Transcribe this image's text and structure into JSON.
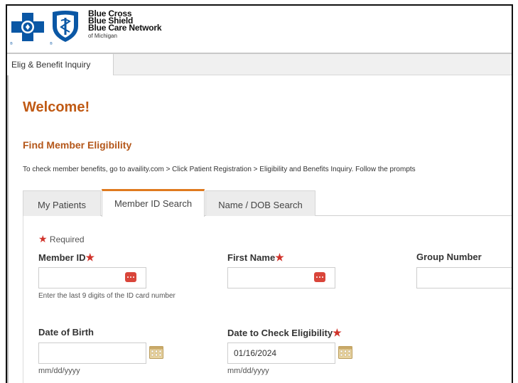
{
  "brand": {
    "line1": "Blue Cross",
    "line2": "Blue Shield",
    "line3": "Blue Care Network",
    "line4": "of Michigan",
    "colors": {
      "primary": "#0a57a5",
      "accent": "#c05a14",
      "required": "#d0332b"
    }
  },
  "topbar": {
    "tab_label": "Elig & Benefit Inquiry"
  },
  "welcome": "Welcome!",
  "section_title": "Find Member Eligibility",
  "instructions": "To check member benefits, go to availity.com > Click Patient Registration > Eligibility and Benefits Inquiry. Follow the prompts",
  "tabs": [
    {
      "label": "My Patients"
    },
    {
      "label": "Member ID Search",
      "active": true
    },
    {
      "label": "Name / DOB Search"
    }
  ],
  "form": {
    "required_note": "Required",
    "required_marker": "★",
    "member_id": {
      "label": "Member ID",
      "value": "",
      "hint": "Enter the last 9 digits of the ID card number"
    },
    "first_name": {
      "label": "First Name",
      "value": ""
    },
    "group_number": {
      "label": "Group Number",
      "value": ""
    },
    "date_of_birth": {
      "label": "Date of Birth",
      "value": "",
      "format_hint": "mm/dd/yyyy"
    },
    "date_to_check": {
      "label": "Date to Check Eligibility",
      "value": "01/16/2024",
      "format_hint": "mm/dd/yyyy"
    }
  },
  "icons": {
    "autofill": "ellipsis-badge-icon",
    "calendar": "calendar-icon",
    "logo_cross": "blue-cross-logo-icon",
    "logo_shield": "blue-shield-logo-icon"
  }
}
